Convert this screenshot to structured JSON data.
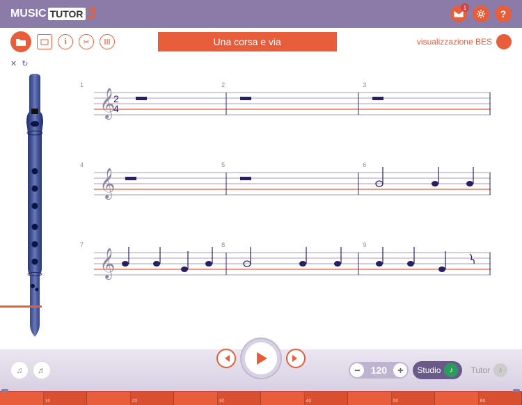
{
  "logo": {
    "part1": "MUSIC",
    "part2": "TUTOR",
    "part3": "3"
  },
  "header": {
    "mail_badge": "1"
  },
  "toolbar": {
    "song_title": "Una corsa e via",
    "bes_label": "visualizzazione BES"
  },
  "close_x": "✕",
  "redo": "↻",
  "score": {
    "rows": [
      {
        "measures": [
          "1",
          "2",
          "3"
        ]
      },
      {
        "measures": [
          "4",
          "5",
          "6"
        ]
      },
      {
        "measures": [
          "7",
          "8",
          "9"
        ]
      }
    ]
  },
  "playback": {
    "tempo": "120",
    "modes": {
      "studio": "Studio",
      "tutor": "Tutor"
    }
  },
  "timeline": {
    "marks": [
      "",
      "10",
      "",
      "20",
      "",
      "30",
      "",
      "40",
      "",
      "50",
      "",
      "60"
    ]
  },
  "icons": {
    "note": "♫",
    "note2": "♬",
    "minus": "−",
    "plus": "+",
    "info": "i",
    "clip": "✂"
  }
}
